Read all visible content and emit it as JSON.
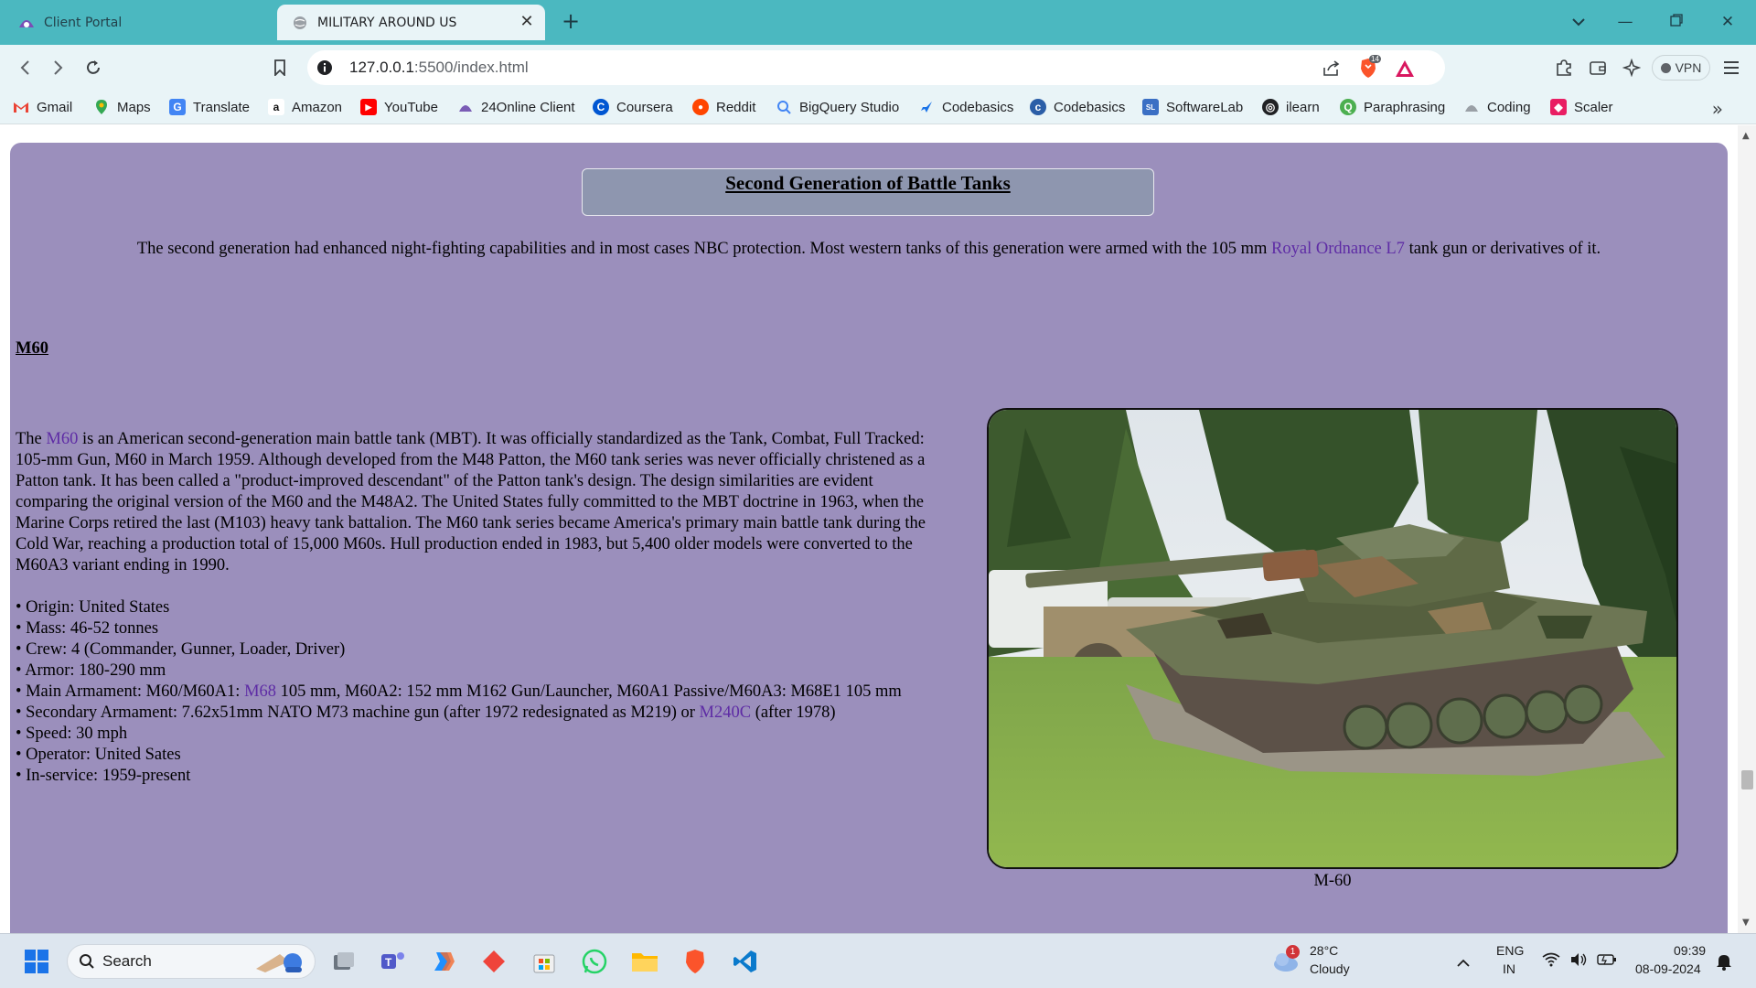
{
  "browser": {
    "tabs": [
      {
        "label": "Client Portal",
        "active": false
      },
      {
        "label": "MILITARY AROUND US",
        "active": true
      }
    ],
    "url_host": "127.0.0.1",
    "url_path": ":5500/index.html",
    "vpn_label": "VPN",
    "brave_badge": "14",
    "bookmarks": [
      "Gmail",
      "Maps",
      "Translate",
      "Amazon",
      "YouTube",
      "24Online Client",
      "Coursera",
      "Reddit",
      "BigQuery Studio",
      "Codebasics",
      "Codebasics",
      "SoftwareLab",
      "ilearn",
      "Paraphrasing",
      "Coding",
      "Scaler"
    ]
  },
  "page": {
    "title": "Second Generation of Battle Tanks",
    "intro_before": "The second generation had enhanced night-fighting capabilities and in most cases NBC protection. Most western tanks of this generation were armed with the 105 mm ",
    "intro_link": "Royal Ordnance L7",
    "intro_after": " tank gun or derivatives of it.",
    "section_heading": "M60",
    "desc_before": "The ",
    "desc_link": "M60",
    "desc_after": " is an American second-generation main battle tank (MBT). It was officially standardized as the Tank, Combat, Full Tracked: 105-mm Gun, M60 in March 1959. Although developed from the M48 Patton, the M60 tank series was never officially christened as a Patton tank. It has been called a \"product-improved descendant\" of the Patton tank's design. The design similarities are evident comparing the original version of the M60 and the M48A2. The United States fully committed to the MBT doctrine in 1963, when the Marine Corps retired the last (M103) heavy tank battalion. The M60 tank series became America's primary main battle tank during the Cold War, reaching a production total of 15,000 M60s. Hull production ended in 1983, but 5,400 older models were converted to the M60A3 variant ending in 1990.",
    "specs": {
      "origin": "• Origin: United States",
      "mass": "• Mass: 46-52 tonnes",
      "crew": "• Crew: 4 (Commander, Gunner, Loader, Driver)",
      "armor": "• Armor: 180-290 mm",
      "main_before": "• Main Armament: M60/M60A1: ",
      "main_link": "M68",
      "main_after": " 105 mm, M60A2: 152 mm M162 Gun/Launcher, M60A1 Passive/M60A3: M68E1 105 mm",
      "secondary_before": "• Secondary Armament: 7.62x51mm NATO M73 machine gun (after 1972 redesignated as M219) or ",
      "secondary_link": "M240C",
      "secondary_after": " (after 1978)",
      "speed": "• Speed: 30 mph",
      "operator": "• Operator: United Sates",
      "service": "• In-service: 1959-present"
    },
    "figure_caption": "M-60"
  },
  "taskbar": {
    "search_label": "Search",
    "weather_temp": "28°C",
    "weather_desc": "Cloudy",
    "weather_badge": "1",
    "lang_top": "ENG",
    "lang_bottom": "IN",
    "time": "09:39",
    "date": "08-09-2024"
  },
  "colors": {
    "page_bg": "#9b8fbc",
    "title_box": "#8e96af",
    "link": "#5e2ca5",
    "tabbar": "#4bb8c0",
    "toolbar": "#e9f4f7"
  }
}
